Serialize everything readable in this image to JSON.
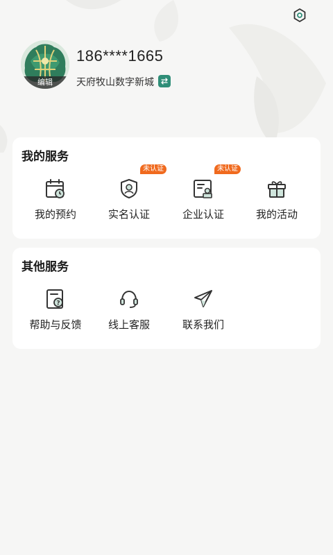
{
  "profile": {
    "phone": "186****1665",
    "location": "天府牧山数字新城",
    "avatar_edit_label": "编辑"
  },
  "my_services": {
    "title": "我的服务",
    "items": [
      {
        "label": "我的预约",
        "icon": "calendar-icon",
        "badge": ""
      },
      {
        "label": "实名认证",
        "icon": "shield-id-icon",
        "badge": "未认证"
      },
      {
        "label": "企业认证",
        "icon": "enterprise-cert-icon",
        "badge": "未认证"
      },
      {
        "label": "我的活动",
        "icon": "gift-icon",
        "badge": ""
      }
    ]
  },
  "other_services": {
    "title": "其他服务",
    "items": [
      {
        "label": "帮助与反馈",
        "icon": "help-doc-icon"
      },
      {
        "label": "线上客服",
        "icon": "headset-icon"
      },
      {
        "label": "联系我们",
        "icon": "paper-plane-icon"
      }
    ]
  },
  "colors": {
    "accent": "#2f8e78",
    "badge": "#f06a1e",
    "background": "#f6f6f5",
    "card": "#ffffff"
  }
}
